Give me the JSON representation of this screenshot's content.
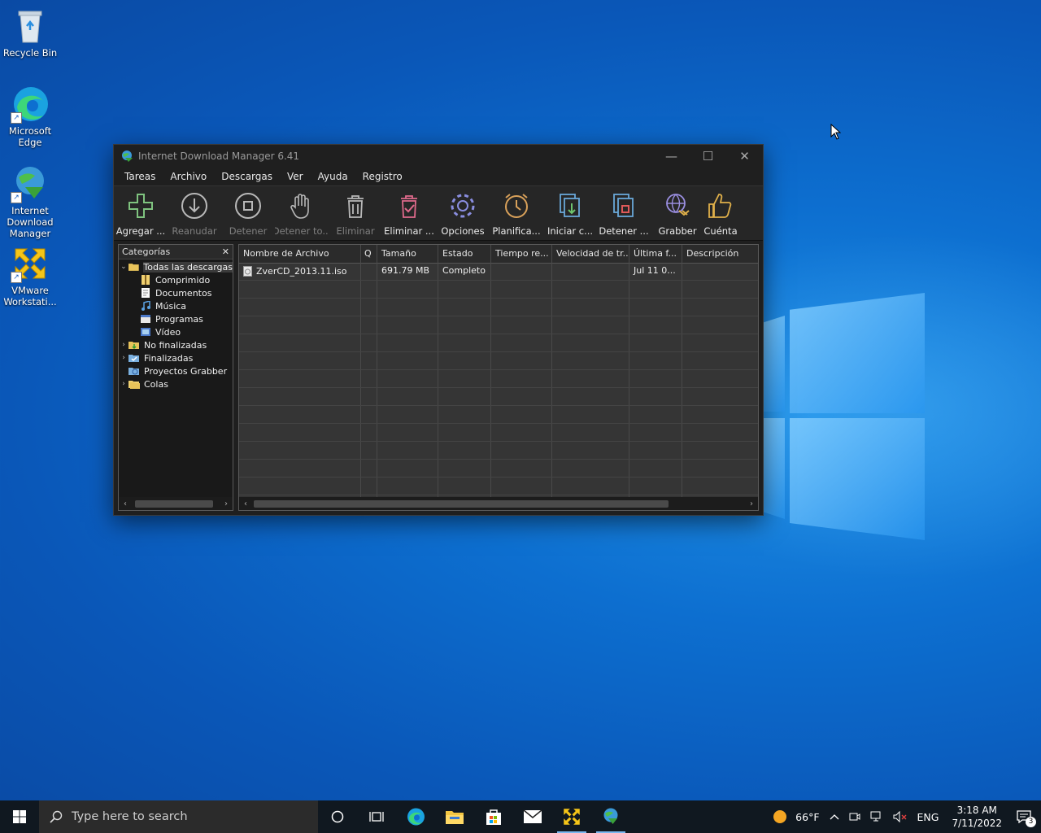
{
  "desktop": {
    "icons": [
      {
        "label": "Recycle Bin"
      },
      {
        "label": "Microsoft Edge"
      },
      {
        "label": "Internet Download Manager"
      },
      {
        "label": "VMware Workstati..."
      }
    ]
  },
  "window": {
    "title": "Internet Download Manager 6.41",
    "menu": [
      "Tareas",
      "Archivo",
      "Descargas",
      "Ver",
      "Ayuda",
      "Registro"
    ],
    "toolbar": [
      {
        "label": "Agregar ...",
        "icon": "add-icon",
        "enabled": true
      },
      {
        "label": "Reanudar",
        "icon": "resume-icon",
        "enabled": false
      },
      {
        "label": "Detener",
        "icon": "stop-icon",
        "enabled": false
      },
      {
        "label": "Detener to...",
        "icon": "stop-all-icon",
        "enabled": false
      },
      {
        "label": "Eliminar",
        "icon": "delete-icon",
        "enabled": false
      },
      {
        "label": "Eliminar ...",
        "icon": "delete-completed-icon",
        "enabled": true
      },
      {
        "label": "Opciones",
        "icon": "options-gear-icon",
        "enabled": true
      },
      {
        "label": "Planifica...",
        "icon": "scheduler-clock-icon",
        "enabled": true
      },
      {
        "label": "Iniciar c...",
        "icon": "start-queue-icon",
        "enabled": true
      },
      {
        "label": "Detener ...",
        "icon": "stop-queue-icon",
        "enabled": true
      },
      {
        "label": "Grabber",
        "icon": "grabber-icon",
        "enabled": true
      },
      {
        "label": "Cuénta",
        "icon": "thumbs-up-icon",
        "enabled": true
      }
    ],
    "categories": {
      "header": "Categorías",
      "close": "✕",
      "items": [
        {
          "label": "Todas las descargas",
          "level": 0,
          "expander": "open",
          "selected": true,
          "icon": "folder-open-icon"
        },
        {
          "label": "Comprimido",
          "level": 1,
          "icon": "archive-icon"
        },
        {
          "label": "Documentos",
          "level": 1,
          "icon": "document-icon"
        },
        {
          "label": "Música",
          "level": 1,
          "icon": "music-icon"
        },
        {
          "label": "Programas",
          "level": 1,
          "icon": "program-icon"
        },
        {
          "label": "Vídeo",
          "level": 1,
          "icon": "video-icon"
        },
        {
          "label": "No finalizadas",
          "level": 0,
          "expander": "closed",
          "icon": "unfinished-folder-icon"
        },
        {
          "label": "Finalizadas",
          "level": 0,
          "expander": "closed",
          "icon": "finished-folder-icon"
        },
        {
          "label": "Proyectos Grabber",
          "level": 0,
          "icon": "grabber-projects-icon"
        },
        {
          "label": "Colas",
          "level": 0,
          "expander": "closed",
          "icon": "queues-folder-icon"
        }
      ]
    },
    "list": {
      "columns": [
        "Nombre de Archivo",
        "Q",
        "Tamaño",
        "Estado",
        "Tiempo re...",
        "Velocidad de tr...",
        "Última f...",
        "Descripción"
      ],
      "rows": [
        [
          "ZverCD_2013.11.iso",
          "",
          "691.79  MB",
          "Completo",
          "",
          "",
          "Jul 11 0...",
          ""
        ]
      ]
    }
  },
  "taskbar": {
    "search_placeholder": "Type here to search",
    "weather": "66°F",
    "language": "ENG",
    "time": "3:18 AM",
    "date": "7/11/2022",
    "notifications": "3"
  }
}
